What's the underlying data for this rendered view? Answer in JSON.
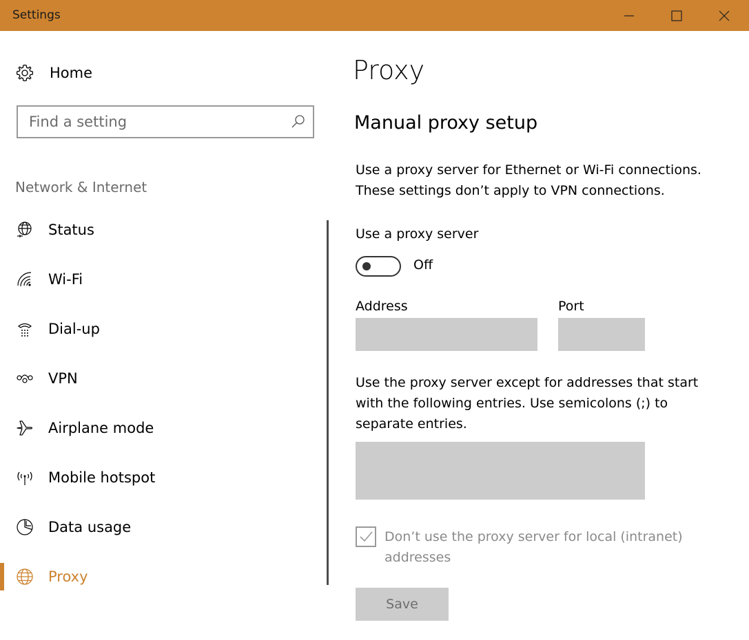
{
  "window": {
    "title": "Settings",
    "accent_color": "#cd8330",
    "controls": [
      "minimize-icon",
      "maximize-icon",
      "close-icon"
    ]
  },
  "sidebar": {
    "home_label": "Home",
    "home_icon": "gear-icon",
    "search_placeholder": "Find a setting",
    "search_icon": "search-icon",
    "section_title": "Network & Internet",
    "items": [
      {
        "label": "Status",
        "icon": "globe-status-icon",
        "active": false
      },
      {
        "label": "Wi-Fi",
        "icon": "wifi-icon",
        "active": false
      },
      {
        "label": "Dial-up",
        "icon": "dialup-icon",
        "active": false
      },
      {
        "label": "VPN",
        "icon": "vpn-icon",
        "active": false
      },
      {
        "label": "Airplane mode",
        "icon": "airplane-icon",
        "active": false
      },
      {
        "label": "Mobile hotspot",
        "icon": "hotspot-icon",
        "active": false
      },
      {
        "label": "Data usage",
        "icon": "pie-chart-icon",
        "active": false
      },
      {
        "label": "Proxy",
        "icon": "globe-icon",
        "active": true
      }
    ]
  },
  "main": {
    "page_title": "Proxy",
    "section_title": "Manual proxy setup",
    "description_line1": "Use a proxy server for Ethernet or Wi-Fi connections.",
    "description_line2": "These settings don’t apply to VPN connections.",
    "use_proxy_label": "Use a proxy server",
    "use_proxy_state": "Off",
    "use_proxy_on": false,
    "address_label": "Address",
    "address_value": "",
    "port_label": "Port",
    "port_value": "",
    "exceptions_description": "Use the proxy server except for addresses that start with the following entries. Use semicolons (;) to separate entries.",
    "exceptions_value": "",
    "local_bypass_label": "Don’t use the proxy server for local (intranet) addresses",
    "local_bypass_checked": true,
    "save_label": "Save"
  }
}
